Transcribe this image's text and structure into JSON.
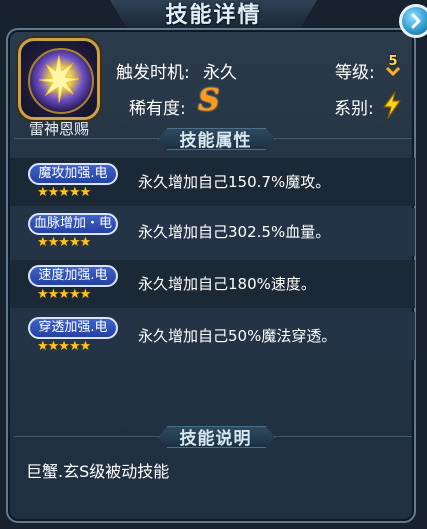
{
  "window": {
    "title": "技能详情"
  },
  "skill": {
    "name": "雷神恩赐",
    "trigger_label": "触发时机:",
    "trigger_value": "永久",
    "level_label": "等级:",
    "level_value": "5",
    "rarity_label": "稀有度:",
    "rarity_value": "S",
    "element_label": "系别:",
    "element_icon": "lightning-icon"
  },
  "sections": {
    "attributes_title": "技能属性",
    "description_title": "技能说明"
  },
  "attributes": [
    {
      "badge": "魔攻加强.电",
      "stars": "★★★★★",
      "text": "永久增加自己150.7%魔攻。"
    },
    {
      "badge": "血脉增加・电",
      "stars": "★★★★★",
      "text": "永久增加自己302.5%血量。"
    },
    {
      "badge": "速度加强.电",
      "stars": "★★★★★",
      "text": "永久增加自己180%速度。"
    },
    {
      "badge": "穿透加强.电",
      "stars": "★★★★★",
      "text": "永久增加自己50%魔法穿透。"
    }
  ],
  "description": "巨蟹.玄S级被动技能",
  "colors": {
    "accent": "#ffc51e",
    "badge": "#3050b8",
    "panel": "#233242"
  }
}
